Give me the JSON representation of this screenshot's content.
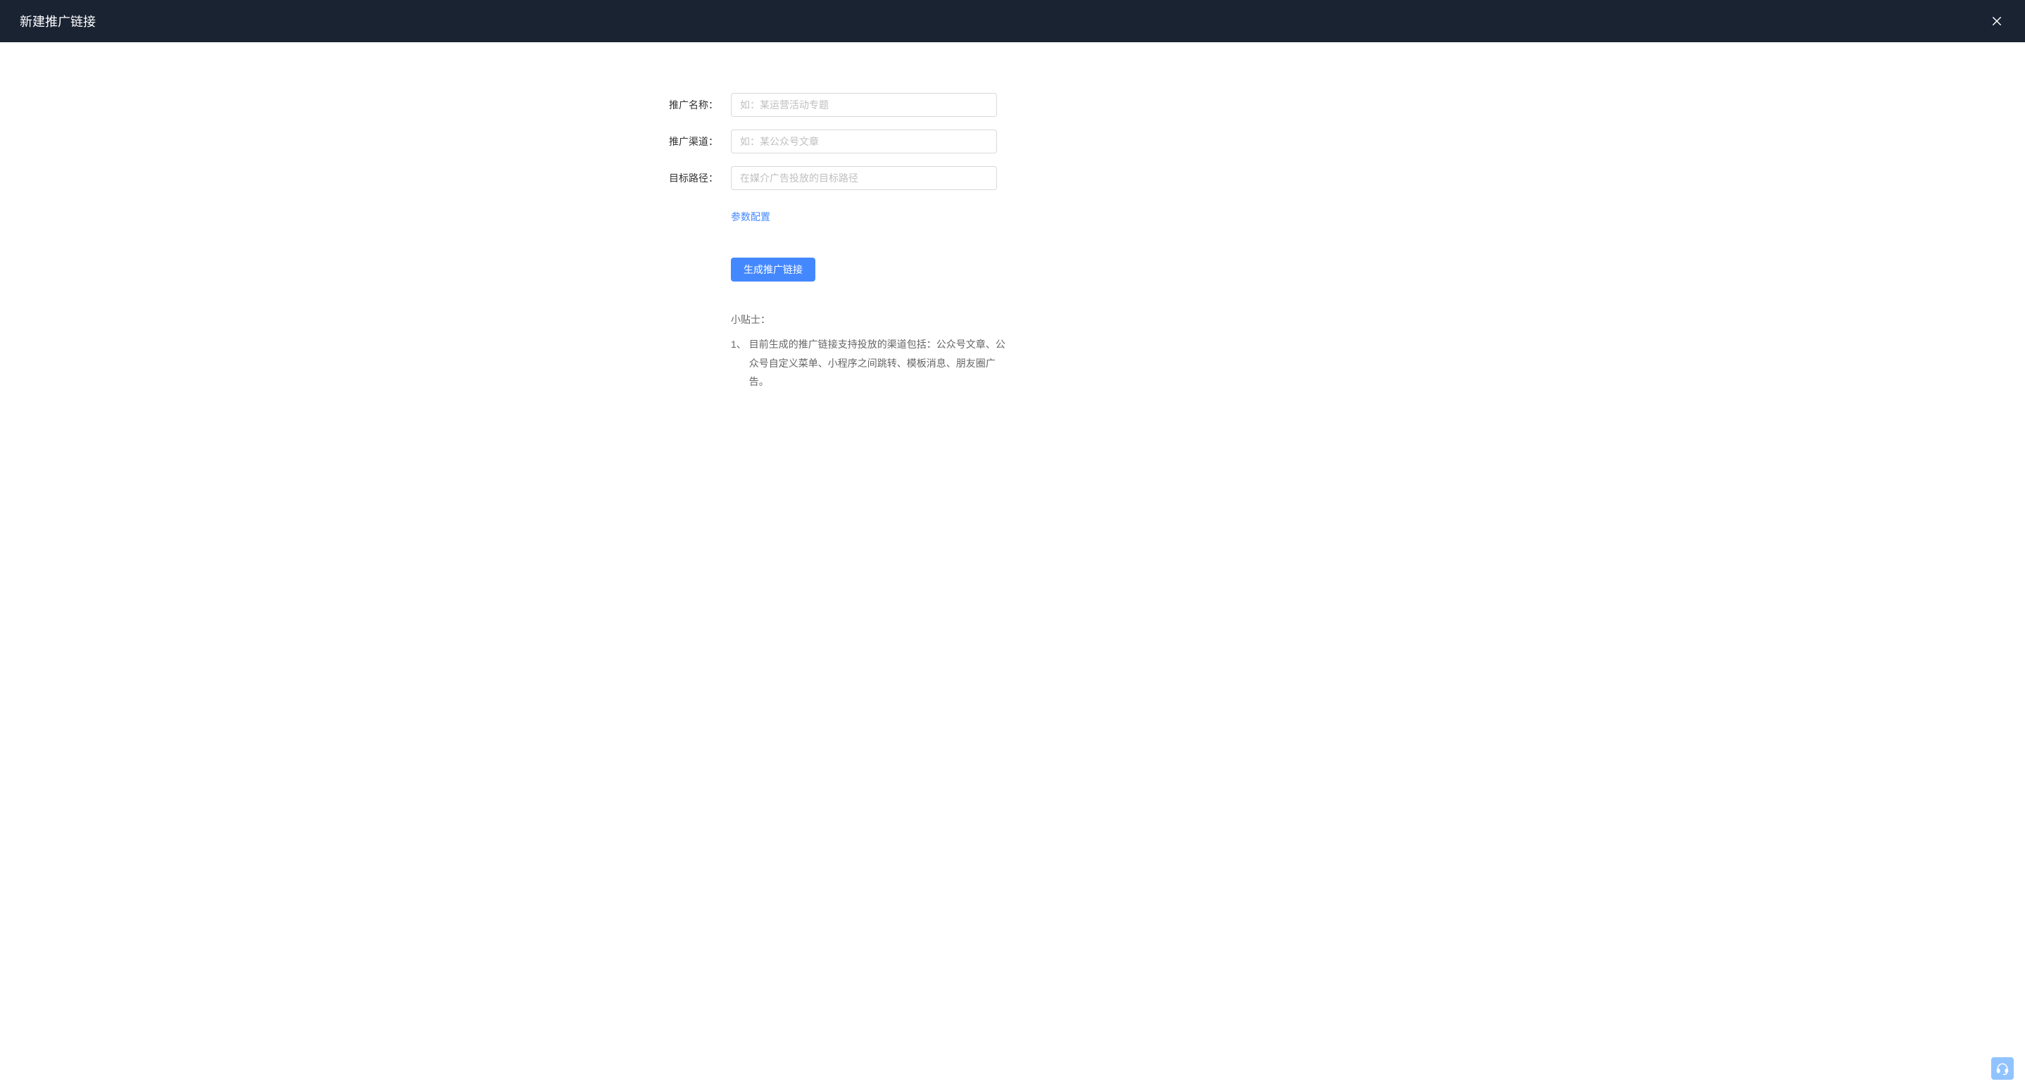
{
  "header": {
    "title": "新建推广链接"
  },
  "form": {
    "name": {
      "label": "推广名称：",
      "value": "",
      "placeholder": "如：某运营活动专题"
    },
    "channel": {
      "label": "推广渠道：",
      "value": "",
      "placeholder": "如：某公众号文章"
    },
    "path": {
      "label": "目标路径：",
      "value": "",
      "placeholder": "在媒介广告投放的目标路径"
    },
    "params_link": "参数配置",
    "generate_button": "生成推广链接"
  },
  "tips": {
    "title": "小贴士：",
    "items": [
      {
        "num": "1、",
        "text": "目前生成的推广链接支持投放的渠道包括：公众号文章、公众号自定义菜单、小程序之间跳转、模板消息、朋友圈广告。"
      }
    ]
  }
}
